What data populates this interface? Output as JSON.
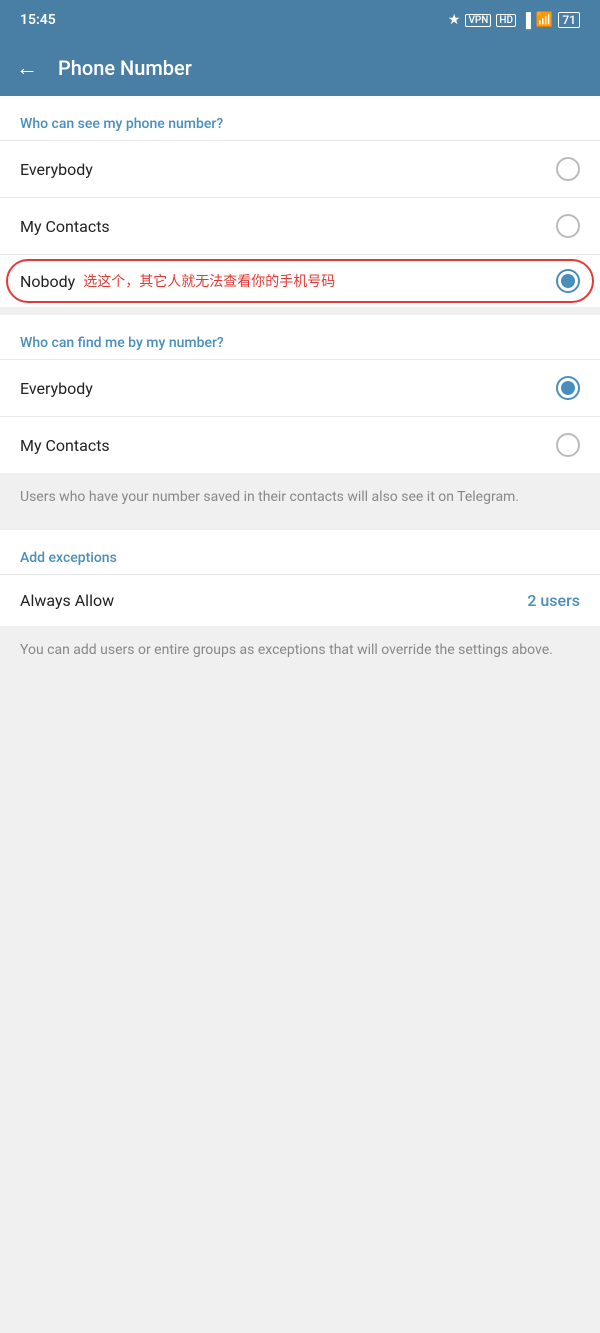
{
  "statusBar": {
    "time": "15:45",
    "icons": "bluetooth vpn hd signal wifi battery"
  },
  "header": {
    "back_label": "←",
    "title": "Phone Number"
  },
  "section1": {
    "label": "Who can see my phone number?"
  },
  "canSeeOptions": [
    {
      "id": "see_everybody",
      "label": "Everybody",
      "selected": false
    },
    {
      "id": "see_my_contacts",
      "label": "My Contacts",
      "selected": false
    },
    {
      "id": "see_nobody",
      "label": "Nobody",
      "selected": true,
      "annotation": "选这个，其它人就无法查看你的手机号码"
    }
  ],
  "section2": {
    "label": "Who can find me by my number?"
  },
  "canFindOptions": [
    {
      "id": "find_everybody",
      "label": "Everybody",
      "selected": true
    },
    {
      "id": "find_my_contacts",
      "label": "My Contacts",
      "selected": false
    }
  ],
  "findInfo": "Users who have your number saved in their contacts will also see it on Telegram.",
  "exceptions": {
    "label": "Add exceptions",
    "always_allow_label": "Always Allow",
    "always_allow_count": "2 users"
  },
  "exceptionsInfo": "You can add users or entire groups as exceptions that will override the settings above."
}
